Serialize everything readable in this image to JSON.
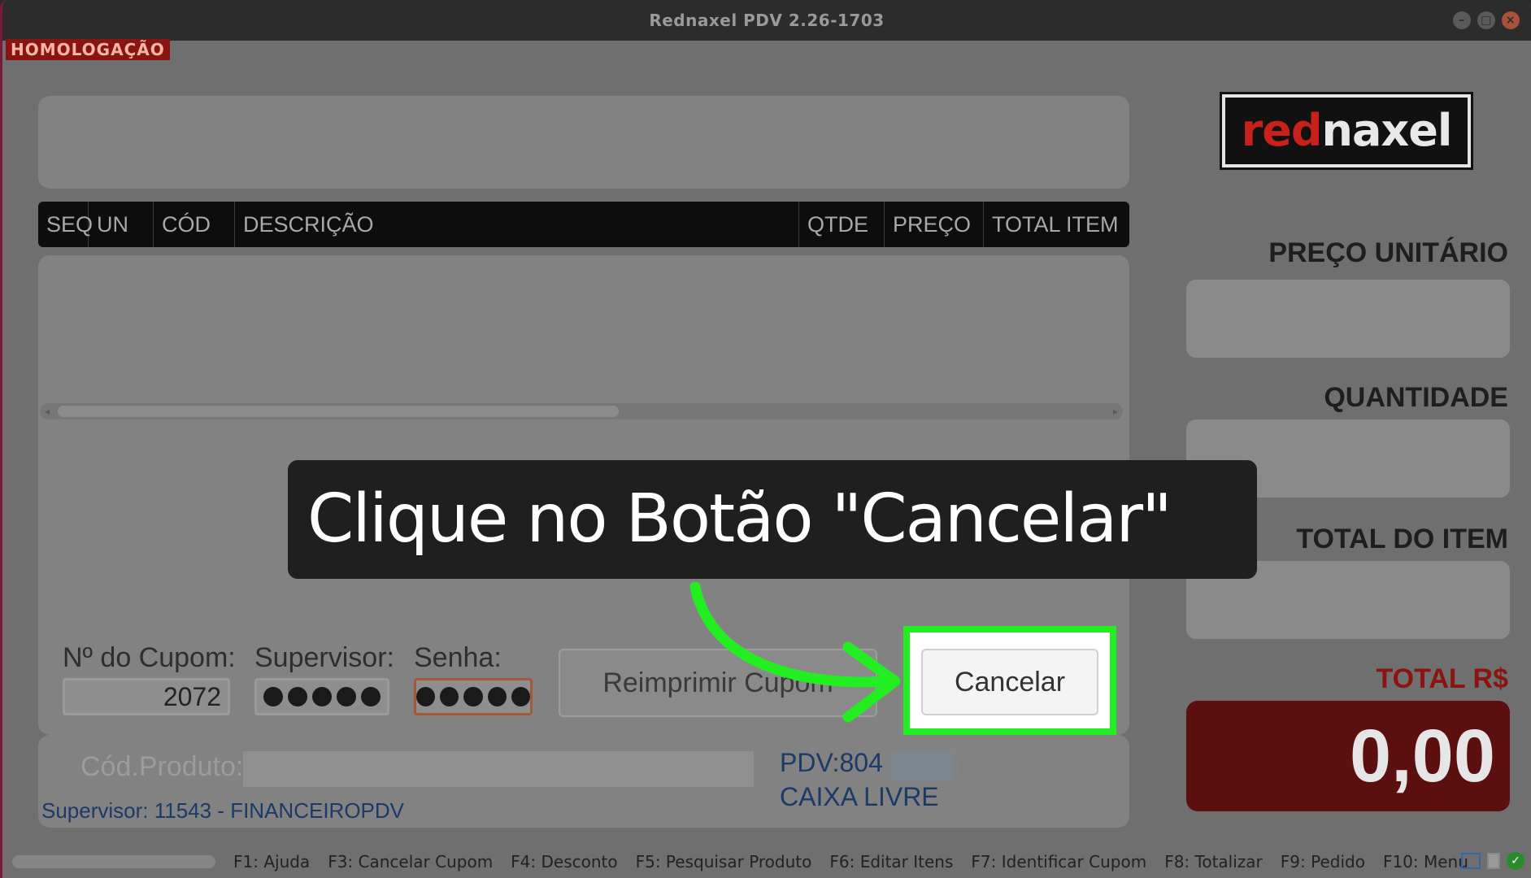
{
  "window": {
    "title": "Rednaxel PDV 2.26-1703"
  },
  "environment_badge": "HOMOLOGAÇÃO",
  "grid": {
    "columns": [
      "SEQ",
      "UN",
      "CÓD",
      "DESCRIÇÃO",
      "QTDE",
      "PREÇO",
      "TOTAL ITEM"
    ]
  },
  "cancel_form": {
    "coupon_label": "Nº do Cupom:",
    "coupon_value": "2072",
    "supervisor_label": "Supervisor:",
    "password_label": "Senha:",
    "reprint_label": "Reimprimir Cupom",
    "cancel_label": "Cancelar"
  },
  "bottom": {
    "product_code_label": "Cód.Produto:",
    "supervisor_info": "Supervisor: 11543 - FINANCEIROPDV",
    "pdv_label": "PDV:804",
    "status": "CAIXA LIVRE"
  },
  "logo": {
    "part1": "red",
    "part2": "naxel"
  },
  "right_panel": {
    "unit_price_label": "PREÇO UNITÁRIO",
    "quantity_label": "QUANTIDADE",
    "item_total_label": "TOTAL DO ITEM",
    "total_label": "TOTAL R$",
    "total_value": "0,00"
  },
  "shortcuts": [
    "F1: Ajuda",
    "F3: Cancelar Cupom",
    "F4: Desconto",
    "F5: Pesquisar Produto",
    "F6: Editar Itens",
    "F7: Identificar Cupom",
    "F8: Totalizar",
    "F9: Pedido",
    "F10: Menu"
  ],
  "callout": {
    "text": "Clique no Botão \"Cancelar\""
  },
  "colors": {
    "highlight": "#22ee22",
    "total_bg": "#5c0f0f",
    "brand_red": "#c8201a"
  }
}
